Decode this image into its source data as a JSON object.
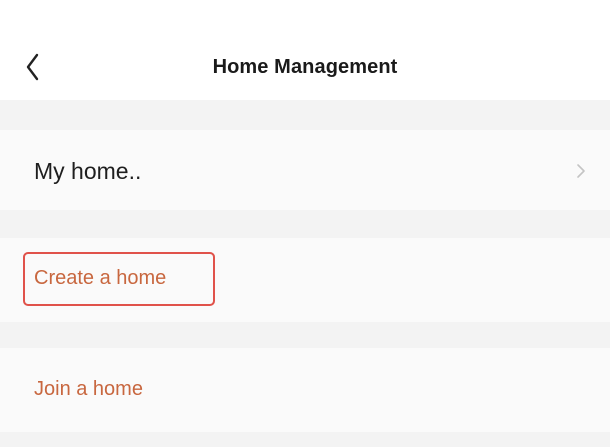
{
  "nav": {
    "title": "Home Management",
    "back_icon": "chevron-left-icon"
  },
  "rows": {
    "home": {
      "label": "My home..",
      "chevron_icon": "chevron-right-icon"
    },
    "create": {
      "label": "Create a home",
      "highlighted": true
    },
    "join": {
      "label": "Join a home"
    }
  },
  "colors": {
    "accent_text": "#c8673f",
    "highlight_border": "#e0524a",
    "section_gap": "#f3f3f3",
    "row_background": "#fafafa",
    "title_text": "#1a1a1a"
  }
}
